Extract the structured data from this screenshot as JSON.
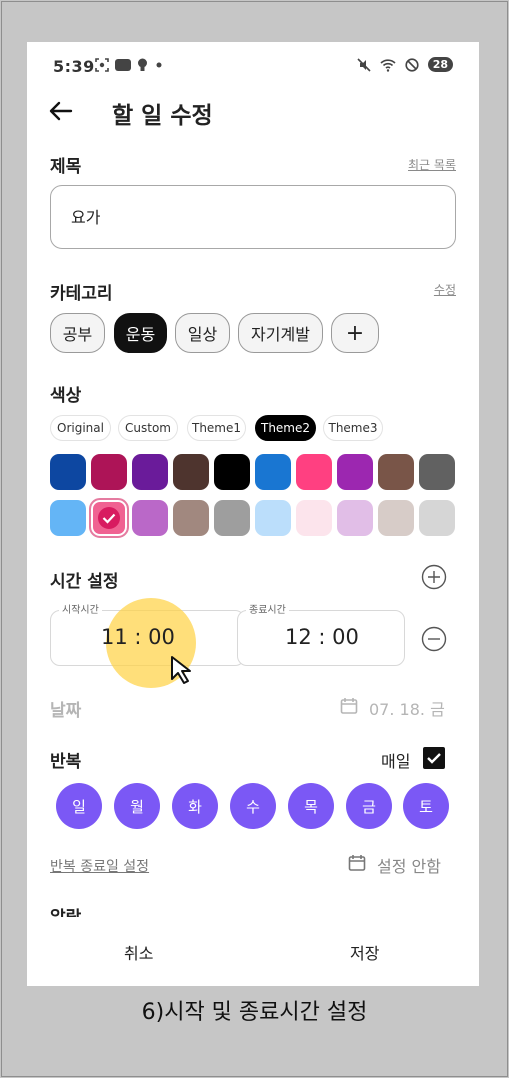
{
  "status_bar": {
    "time": "5:39",
    "left_icons": [
      "screenshot-icon",
      "app-badge-icon",
      "bulb-icon",
      "dot-icon"
    ],
    "right_icons": [
      "mute-icon",
      "wifi-icon",
      "dnd-icon"
    ],
    "battery": "28"
  },
  "header": {
    "title": "할 일 수정"
  },
  "title_section": {
    "label": "제목",
    "recent_link": "최근 목록",
    "value": "요가"
  },
  "category_section": {
    "label": "카테고리",
    "edit_link": "수정",
    "chips": [
      {
        "label": "공부",
        "active": false
      },
      {
        "label": "운동",
        "active": true
      },
      {
        "label": "일상",
        "active": false
      },
      {
        "label": "자기계발",
        "active": false
      }
    ],
    "add_label": "+"
  },
  "color_section": {
    "label": "색상",
    "themes": [
      {
        "label": "Original",
        "active": false
      },
      {
        "label": "Custom",
        "active": false
      },
      {
        "label": "Theme1",
        "active": false
      },
      {
        "label": "Theme2",
        "active": true
      },
      {
        "label": "Theme3",
        "active": false
      }
    ],
    "row1": [
      "#0d47a1",
      "#ad1457",
      "#6a1b9a",
      "#4e342e",
      "#000000",
      "#1976d2",
      "#ff4081",
      "#9c27b0",
      "#795548",
      "#616161"
    ],
    "row2": [
      "#64b5f6",
      "#f06292",
      "#ba68c8",
      "#a1887f",
      "#9e9e9e",
      "#bbdefb",
      "#fce4ec",
      "#e1bee7",
      "#d7ccc8",
      "#d6d6d6"
    ],
    "selected": "#f06292"
  },
  "time_section": {
    "label": "시간 설정",
    "start_caption": "시작시간",
    "start_value": "11 : 00",
    "end_caption": "종료시간",
    "end_value": "12 : 00"
  },
  "date_section": {
    "label": "날짜",
    "value": "07. 18. 금"
  },
  "repeat_section": {
    "label": "반복",
    "daily_label": "매일",
    "daily_checked": true,
    "days": [
      "일",
      "월",
      "화",
      "수",
      "목",
      "금",
      "토"
    ],
    "end_date_link": "반복 종료일 설정",
    "end_date_value": "설정 안함"
  },
  "alarm_section": {
    "label": "알람"
  },
  "bottom": {
    "cancel": "취소",
    "save": "저장"
  },
  "caption": "6)시작 및 종료시간 설정"
}
